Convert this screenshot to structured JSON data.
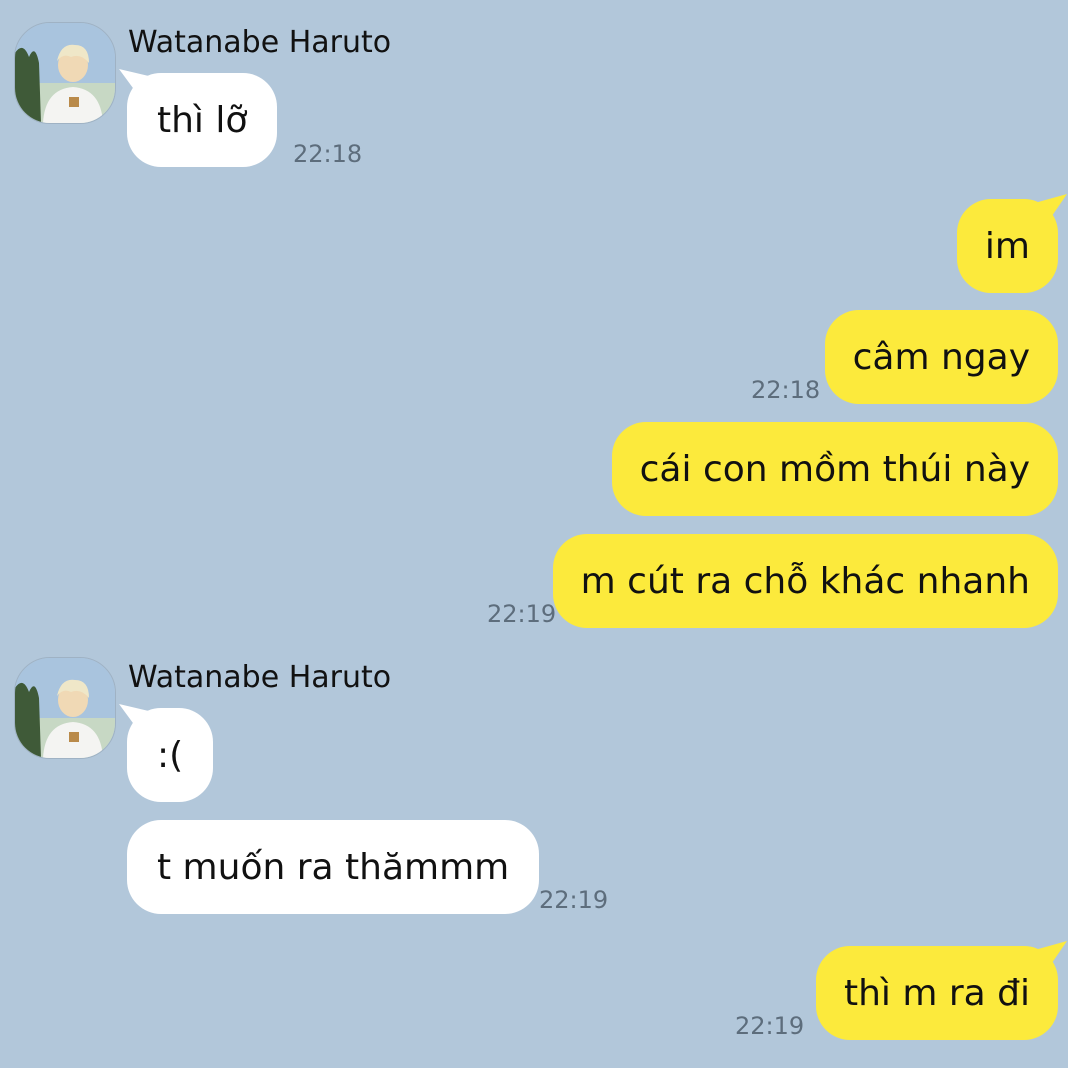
{
  "colors": {
    "background": "#b2c7da",
    "incoming_bubble": "#ffffff",
    "outgoing_bubble": "#fcea3c",
    "timestamp": "#5d6d7c"
  },
  "contact": {
    "name": "Watanabe Haruto",
    "avatar_icon": "profile-photo"
  },
  "messages": [
    {
      "dir": "in",
      "text": "thì lỡ",
      "time": "22:18"
    },
    {
      "dir": "out",
      "text": "im",
      "time": ""
    },
    {
      "dir": "out",
      "text": "câm ngay",
      "time": "22:18"
    },
    {
      "dir": "out",
      "text": "cái con mồm thúi này",
      "time": ""
    },
    {
      "dir": "out",
      "text": "m cút ra chỗ khác nhanh",
      "time": "22:19"
    },
    {
      "dir": "in",
      "text": ":(",
      "time": ""
    },
    {
      "dir": "in",
      "text": "t muốn ra thămmm",
      "time": "22:19"
    },
    {
      "dir": "out",
      "text": "thì m ra đi",
      "time": "22:19"
    }
  ]
}
